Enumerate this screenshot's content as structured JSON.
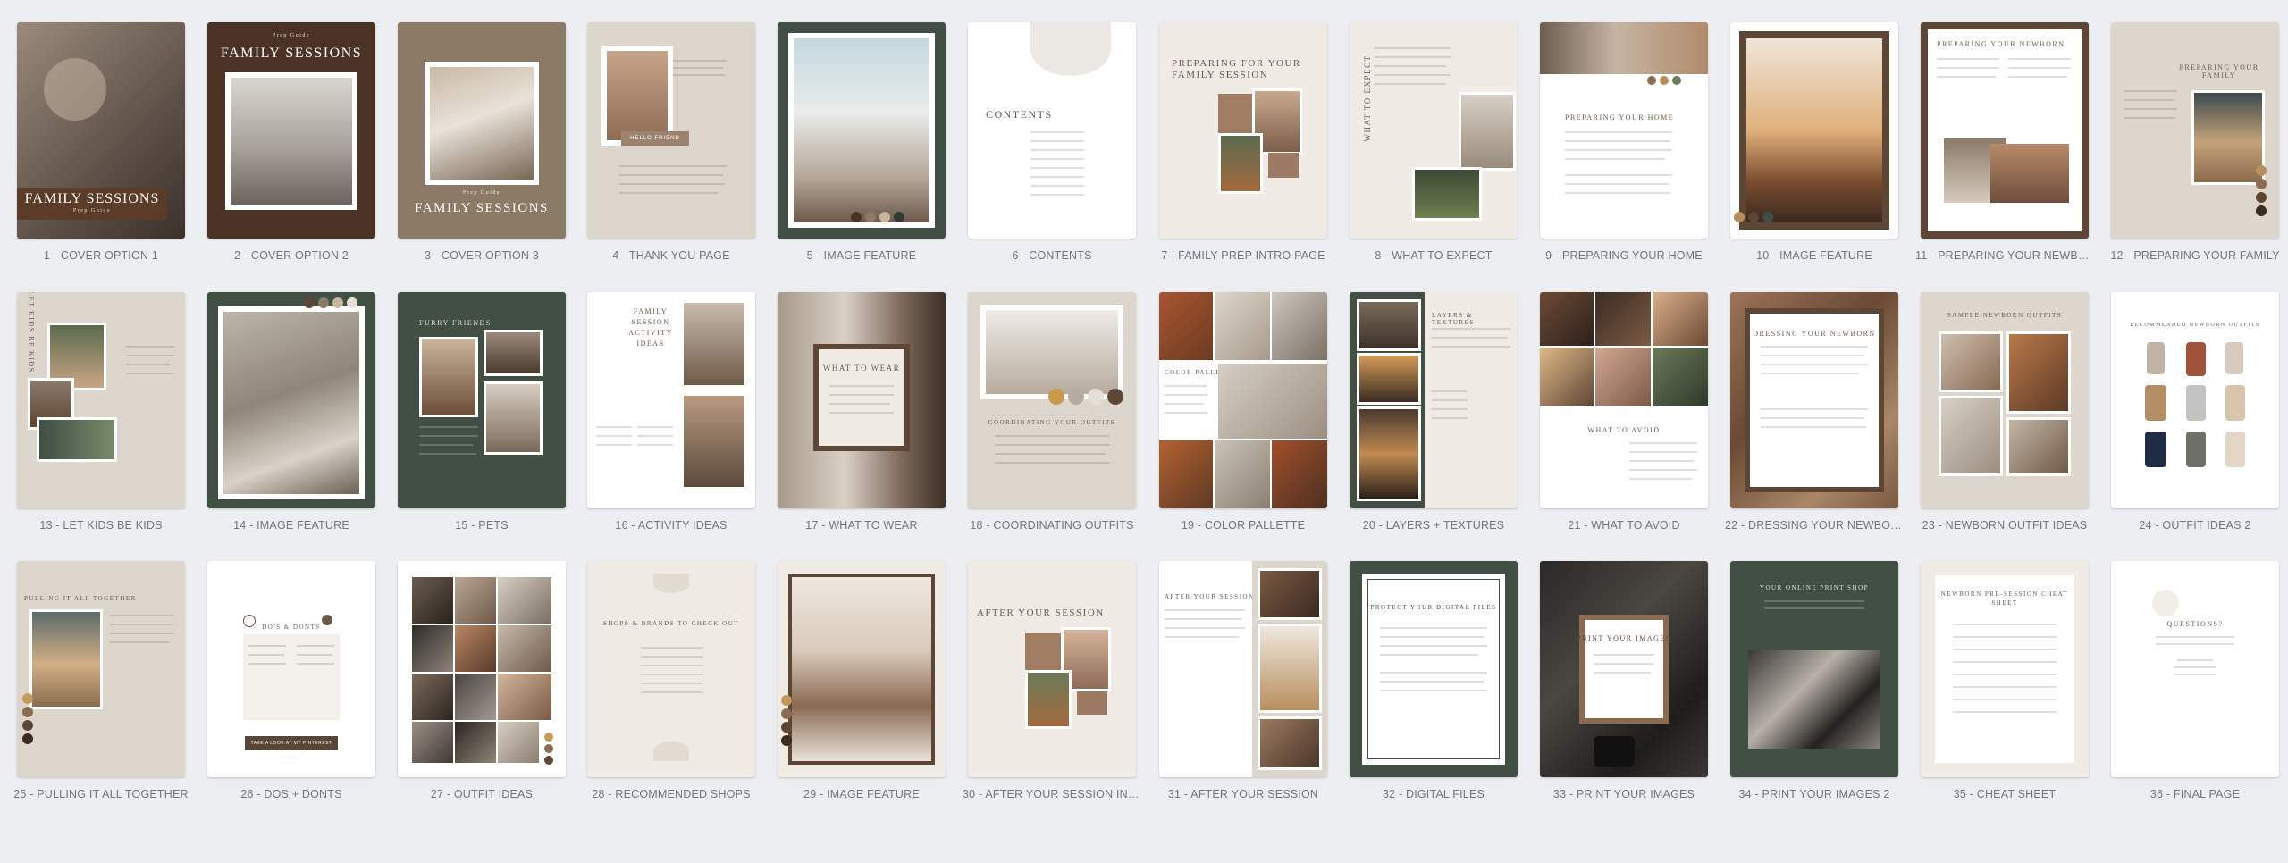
{
  "colors": {
    "background": "#eceef2",
    "caption": "#6f7680",
    "brown_dark": "#4a3325",
    "taupe": "#8b7a66",
    "beige": "#ddd6cd",
    "cream": "#f3efea",
    "green": "#414f45",
    "white": "#ffffff"
  },
  "pages": [
    {
      "caption": "1 - COVER OPTION 1",
      "title": "FAMILY SESSIONS",
      "subtitle": "Prep Guide"
    },
    {
      "caption": "2 - COVER OPTION 2",
      "title": "FAMILY SESSIONS",
      "subtitle": "Prep Guide"
    },
    {
      "caption": "3 - COVER OPTION 3",
      "title": "FAMILY SESSIONS",
      "subtitle": "Prep Guide"
    },
    {
      "caption": "4 - THANK YOU PAGE",
      "title": "HELLO FRIEND"
    },
    {
      "caption": "5 - IMAGE FEATURE"
    },
    {
      "caption": "6 - CONTENTS",
      "title": "CONTENTS"
    },
    {
      "caption": "7 - FAMILY PREP INTRO PAGE",
      "title": "PREPARING FOR YOUR FAMILY SESSION"
    },
    {
      "caption": "8 - WHAT TO EXPECT",
      "title": "WHAT TO EXPECT"
    },
    {
      "caption": "9 - PREPARING YOUR HOME",
      "title": "PREPARING YOUR HOME"
    },
    {
      "caption": "10 - IMAGE FEATURE"
    },
    {
      "caption": "11 - PREPARING YOUR NEWBO...",
      "title": "PREPARING YOUR NEWBORN"
    },
    {
      "caption": "12 - PREPARING YOUR FAMILY",
      "title": "PREPARING YOUR FAMILY"
    },
    {
      "caption": "13 - LET KIDS BE KIDS",
      "title": "LET KIDS BE KIDS"
    },
    {
      "caption": "14 - IMAGE FEATURE"
    },
    {
      "caption": "15 - PETS",
      "title": "FURRY FRIENDS"
    },
    {
      "caption": "16 - ACTIVITY IDEAS",
      "title": "FAMILY SESSION ACTIVITY IDEAS"
    },
    {
      "caption": "17 - WHAT TO WEAR",
      "title": "WHAT TO WEAR"
    },
    {
      "caption": "18 - COORDINATING OUTFITS",
      "title": "COORDINATING YOUR OUTFITS"
    },
    {
      "caption": "19 - COLOR PALLETTE",
      "title": "COLOR PALLETTE"
    },
    {
      "caption": "20 - LAYERS + TEXTURES",
      "title": "LAYERS & TEXTURES"
    },
    {
      "caption": "21 - WHAT TO AVOID",
      "title": "WHAT TO AVOID"
    },
    {
      "caption": "22 - DRESSING YOUR NEWBORN",
      "title": "DRESSING YOUR NEWBORN"
    },
    {
      "caption": "23 - NEWBORN OUTFIT IDEAS",
      "title": "SAMPLE NEWBORN OUTFITS"
    },
    {
      "caption": "24 - OUTFIT IDEAS 2",
      "title": "RECOMMENDED NEWBORN OUTFITS"
    },
    {
      "caption": "25 - PULLING IT ALL TOGETHER",
      "title": "PULLING IT ALL TOGETHER"
    },
    {
      "caption": "26 - DOS + DONTS",
      "title": "DO'S & DONTS",
      "button": "TAKE A LOOK AT MY PINTEREST BOARDS"
    },
    {
      "caption": "27 - OUTFIT IDEAS"
    },
    {
      "caption": "28 - RECOMMENDED SHOPS",
      "title": "SHOPS & BRANDS TO CHECK OUT"
    },
    {
      "caption": "29 - IMAGE FEATURE"
    },
    {
      "caption": "30 - AFTER YOUR SESSION INT...",
      "title": "AFTER YOUR SESSION"
    },
    {
      "caption": "31 - AFTER YOUR SESSION",
      "title": "AFTER YOUR SESSION"
    },
    {
      "caption": "32 - DIGITAL FILES",
      "title": "PROTECT YOUR DIGITAL FILES"
    },
    {
      "caption": "33 - PRINT YOUR IMAGES",
      "title": "PRINT YOUR IMAGES"
    },
    {
      "caption": "34 - PRINT YOUR IMAGES 2",
      "title": "YOUR ONLINE PRINT SHOP"
    },
    {
      "caption": "35 - CHEAT SHEET",
      "title": "NEWBORN PRE-SESSION CHEAT SHEET"
    },
    {
      "caption": "36 - FINAL PAGE",
      "title": "QUESTIONS?"
    }
  ]
}
